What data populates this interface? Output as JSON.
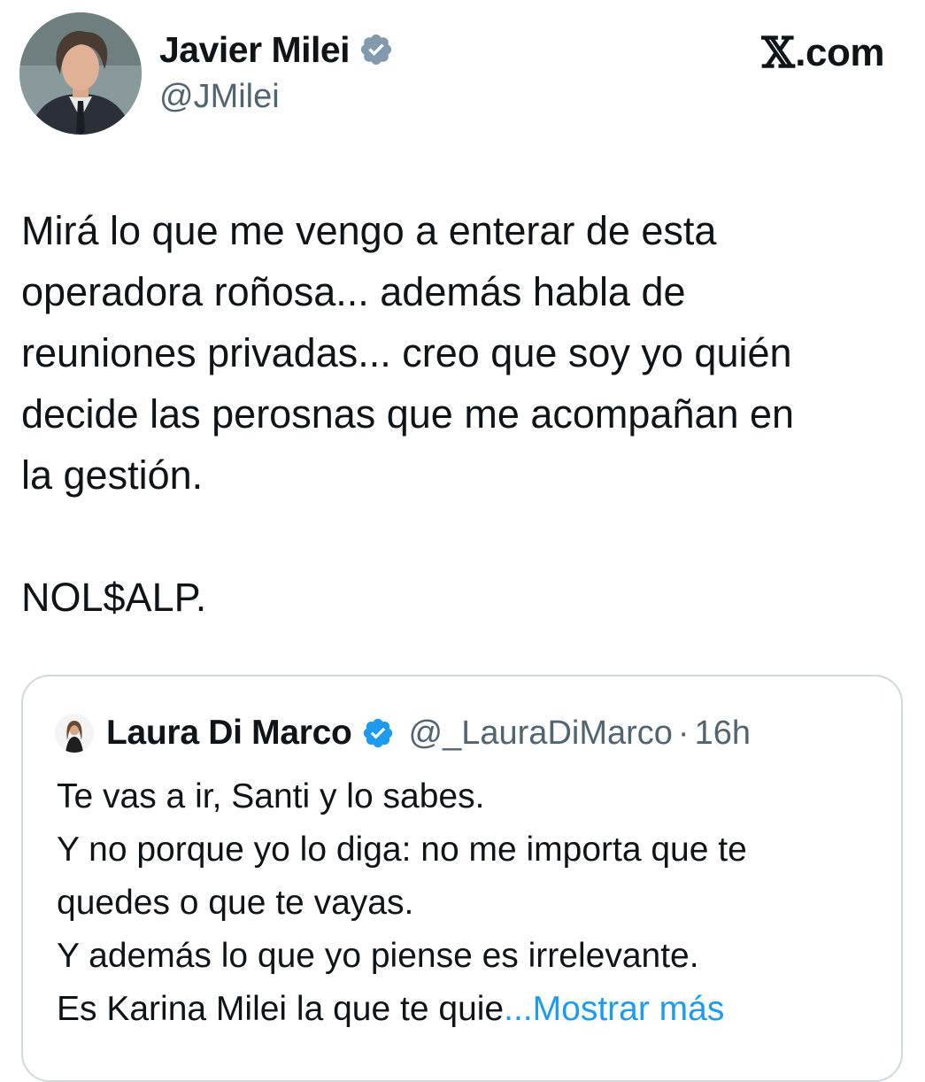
{
  "author": {
    "name": "Javier Milei",
    "handle": "@JMilei"
  },
  "brand": {
    "label": ".com"
  },
  "tweet": {
    "lines": [
      "Mirá lo que me vengo a enterar de esta",
      "operadora roñosa... además habla de",
      "reuniones privadas... creo que soy yo quién",
      "decide las perosnas que me acompañan en",
      "la gestión."
    ],
    "signoff": "NOL$ALP."
  },
  "quoted": {
    "name": "Laura Di Marco",
    "handle": "@_LauraDiMarco",
    "separator": "·",
    "time": "16h",
    "lines": [
      "Te vas a ir, Santi y lo sabes.",
      "Y no porque yo lo diga: no me importa que te",
      "quedes o que te vayas.",
      "Y además lo que yo piense es irrelevante."
    ],
    "last_line": "Es Karina Milei la que te quie",
    "ellipsis": "...",
    "show_more": "Mostrar más"
  },
  "colors": {
    "text": "#0f1419",
    "secondary": "#536471",
    "accent": "#1d9bf0",
    "border": "#cfd9de",
    "verified_gray": "#829aab"
  },
  "icons": {
    "author_badge": "verified-gray-badge-icon",
    "quoted_badge": "verified-blue-badge-icon",
    "brand": "x-logo-icon"
  }
}
